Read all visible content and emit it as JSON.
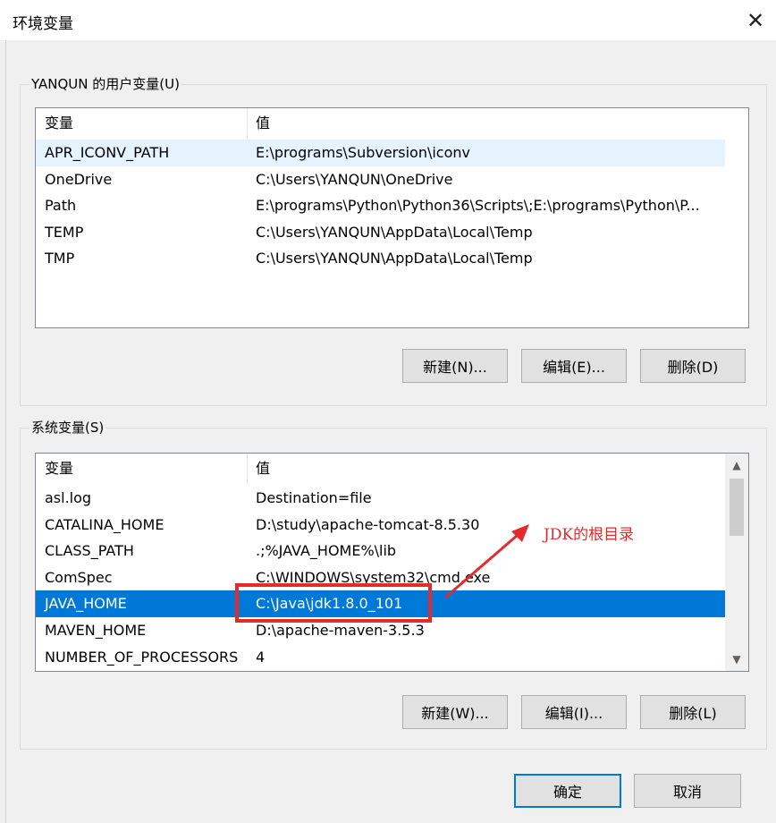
{
  "window": {
    "title": "环境变量",
    "close_glyph": "✕"
  },
  "user_vars": {
    "group_label": "YANQUN 的用户变量(U)",
    "col_name": "变量",
    "col_value": "值",
    "rows": [
      {
        "name": "APR_ICONV_PATH",
        "value": "E:\\programs\\Subversion\\iconv"
      },
      {
        "name": "OneDrive",
        "value": "C:\\Users\\YANQUN\\OneDrive"
      },
      {
        "name": "Path",
        "value": "E:\\programs\\Python\\Python36\\Scripts\\;E:\\programs\\Python\\P..."
      },
      {
        "name": "TEMP",
        "value": "C:\\Users\\YANQUN\\AppData\\Local\\Temp"
      },
      {
        "name": "TMP",
        "value": "C:\\Users\\YANQUN\\AppData\\Local\\Temp"
      }
    ],
    "buttons": {
      "new": "新建(N)...",
      "edit": "编辑(E)...",
      "delete": "删除(D)"
    }
  },
  "system_vars": {
    "group_label": "系统变量(S)",
    "col_name": "变量",
    "col_value": "值",
    "rows": [
      {
        "name": "asl.log",
        "value": "Destination=file"
      },
      {
        "name": "CATALINA_HOME",
        "value": "D:\\study\\apache-tomcat-8.5.30"
      },
      {
        "name": "CLASS_PATH",
        "value": ".;%JAVA_HOME%\\lib"
      },
      {
        "name": "ComSpec",
        "value": "C:\\WINDOWS\\system32\\cmd.exe"
      },
      {
        "name": "JAVA_HOME",
        "value": "C:\\Java\\jdk1.8.0_101"
      },
      {
        "name": "MAVEN_HOME",
        "value": "D:\\apache-maven-3.5.3"
      },
      {
        "name": "NUMBER_OF_PROCESSORS",
        "value": "4"
      }
    ],
    "selected_row": "JAVA_HOME",
    "buttons": {
      "new": "新建(W)...",
      "edit": "编辑(I)...",
      "delete": "删除(L)"
    }
  },
  "dialog_buttons": {
    "ok": "确定",
    "cancel": "取消"
  },
  "annotation": {
    "text": "JDK的根目录",
    "color": "#e32b2b"
  },
  "colors": {
    "selection": "#0078d7",
    "hover": "#e5f3ff"
  }
}
